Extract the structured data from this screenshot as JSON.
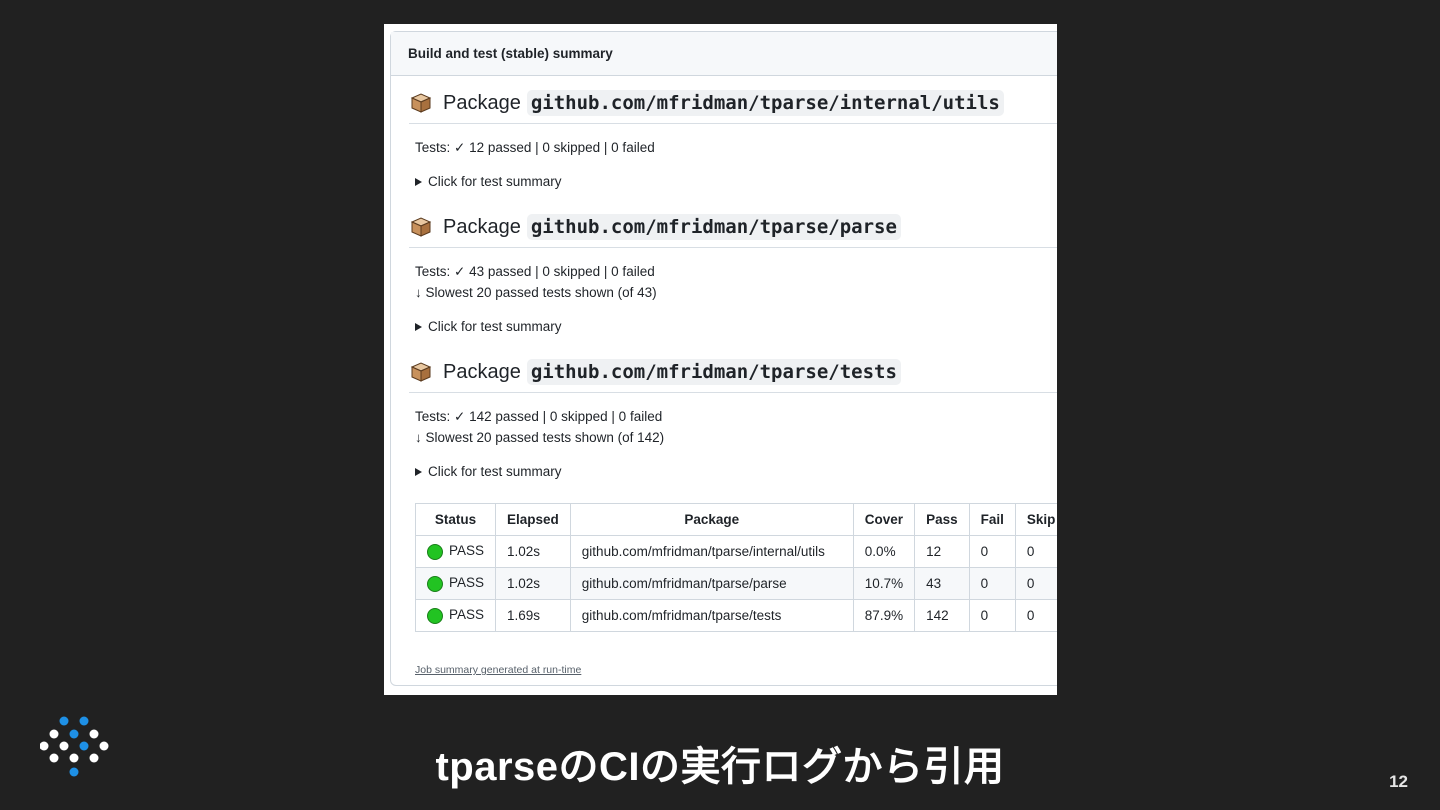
{
  "summary": {
    "title": "Build and test (stable) summary",
    "package_word": "Package",
    "packages": [
      {
        "path": "github.com/mfridman/tparse/internal/utils",
        "tests_line": "Tests: ✓ 12 passed | 0 skipped | 0 failed",
        "slowest_line": "",
        "toggle": "Click for test summary"
      },
      {
        "path": "github.com/mfridman/tparse/parse",
        "tests_line": "Tests: ✓ 43 passed | 0 skipped | 0 failed",
        "slowest_line": "↓ Slowest 20 passed tests shown (of 43)",
        "toggle": "Click for test summary"
      },
      {
        "path": "github.com/mfridman/tparse/tests",
        "tests_line": "Tests: ✓ 142 passed | 0 skipped | 0 failed",
        "slowest_line": "↓ Slowest 20 passed tests shown (of 142)",
        "toggle": "Click for test summary"
      }
    ],
    "table": {
      "headers": [
        "Status",
        "Elapsed",
        "Package",
        "Cover",
        "Pass",
        "Fail",
        "Skip"
      ],
      "rows": [
        [
          "PASS",
          "1.02s",
          "github.com/mfridman/tparse/internal/utils",
          "0.0%",
          "12",
          "0",
          "0"
        ],
        [
          "PASS",
          "1.02s",
          "github.com/mfridman/tparse/parse",
          "10.7%",
          "43",
          "0",
          "0"
        ],
        [
          "PASS",
          "1.69s",
          "github.com/mfridman/tparse/tests",
          "87.9%",
          "142",
          "0",
          "0"
        ]
      ],
      "status_color": "#22c322"
    },
    "footer": "Job summary generated at run-time"
  },
  "slide": {
    "caption": "tparseのCIの実行ログから引用",
    "page_number": "12",
    "accent_colors": [
      "#1e90e6",
      "#ffffff"
    ]
  },
  "icons": {
    "package": "package-box-icon",
    "toggle": "triangle-right-icon",
    "status": "green-circle-icon",
    "logo": "dot-grid-logo"
  }
}
